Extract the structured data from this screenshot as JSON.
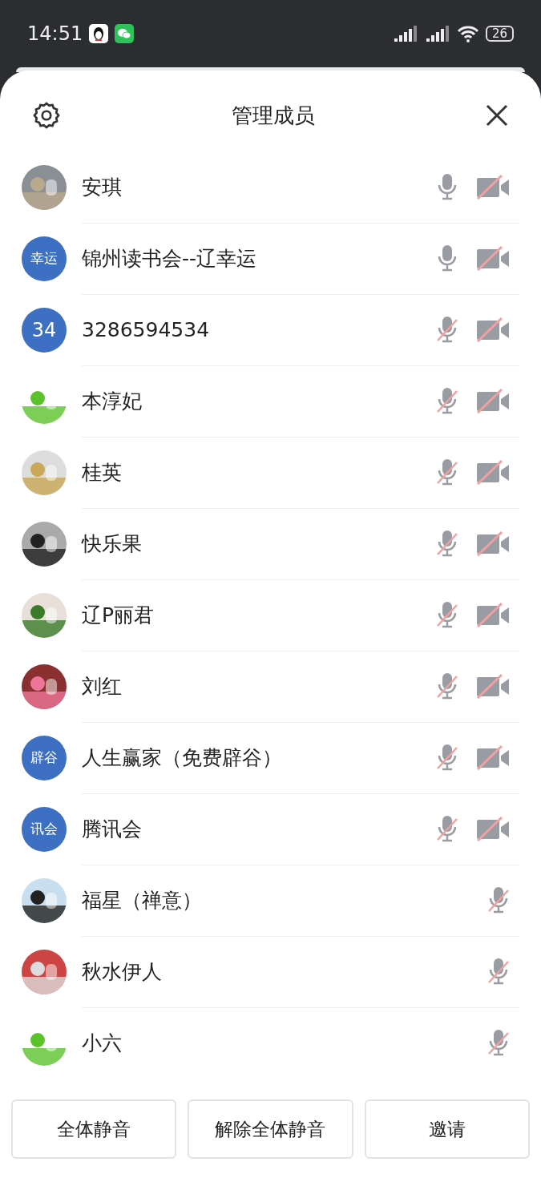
{
  "status_bar": {
    "time": "14:51",
    "battery": "26"
  },
  "sheet": {
    "title": "管理成员"
  },
  "members": [
    {
      "name": "安琪",
      "mic_muted": false,
      "camera": {
        "muted": true
      }
    },
    {
      "name": "锦州读书会--辽幸运",
      "avatar": {
        "kind": "text",
        "label": "幸运"
      },
      "mic_muted": false,
      "camera": {
        "muted": true
      }
    },
    {
      "name": "3286594534",
      "avatar": {
        "kind": "text",
        "label": "34"
      },
      "mic_muted": true,
      "camera": {
        "muted": true
      }
    },
    {
      "name": "本淳妃",
      "mic_muted": true,
      "camera": {
        "muted": true
      }
    },
    {
      "name": "桂英",
      "mic_muted": true,
      "camera": {
        "muted": true
      }
    },
    {
      "name": "快乐果",
      "mic_muted": true,
      "camera": {
        "muted": true
      }
    },
    {
      "name": "辽P丽君",
      "mic_muted": true,
      "camera": {
        "muted": true
      }
    },
    {
      "name": "刘红",
      "mic_muted": true,
      "camera": {
        "muted": true
      }
    },
    {
      "name": "人生赢家（免费辟谷）",
      "avatar": {
        "kind": "text",
        "label": "辟谷"
      },
      "mic_muted": true,
      "camera": {
        "muted": true
      }
    },
    {
      "name": "腾讯会",
      "avatar": {
        "kind": "text",
        "label": "讯会"
      },
      "mic_muted": true,
      "camera": {
        "muted": true
      }
    },
    {
      "name": "福星（禅意）",
      "mic_muted": true
    },
    {
      "name": "秋水伊人",
      "mic_muted": true
    },
    {
      "name": "小六",
      "mic_muted": true
    }
  ],
  "buttons": [
    "全体静音",
    "解除全体静音",
    "邀请"
  ]
}
